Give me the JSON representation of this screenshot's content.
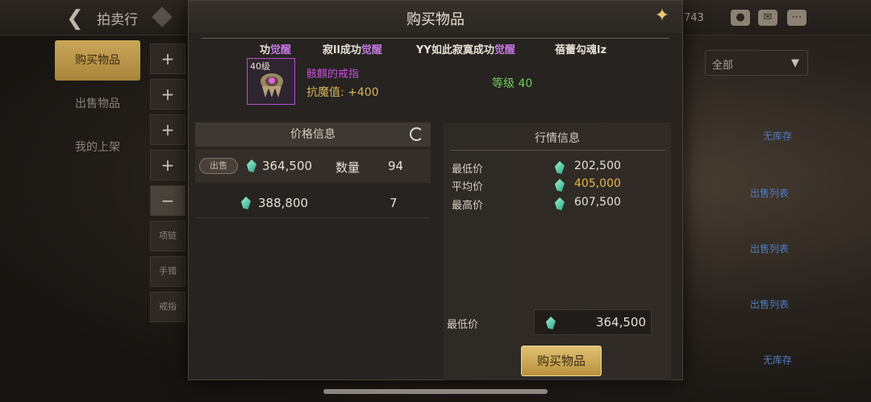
{
  "topbar": {
    "back_icon": "back-arrow-icon",
    "title": "拍卖行",
    "currency_count": "743"
  },
  "sidebar": {
    "items": [
      {
        "label": "购买物品",
        "active": true
      },
      {
        "label": "出售物品",
        "active": false
      },
      {
        "label": "我的上架",
        "active": false
      }
    ]
  },
  "categories": {
    "plus_buttons": [
      "+",
      "+",
      "+",
      "+"
    ],
    "minus": "−",
    "subs": [
      "项链",
      "手镯",
      "戒指"
    ]
  },
  "right_list": {
    "filter_value": "全部",
    "tags": [
      "无库存",
      "出售列表",
      "出售列表",
      "出售列表",
      "无库存"
    ]
  },
  "modal": {
    "title": "购买物品",
    "close_icon": "close-star-icon",
    "names": [
      {
        "pre": "功",
        "hl": "觉醒"
      },
      {
        "pre": "寂ll成功",
        "hl": "觉醒"
      },
      {
        "pre": "YY如此寂寞成功",
        "hl": "觉醒"
      },
      {
        "pre": "蓓蕾勾魂lz",
        "hl": ""
      }
    ],
    "item": {
      "level": "40级",
      "name": "骸麒的戒指",
      "stat": "抗魔值: +400",
      "grade": "等级 40"
    },
    "price_info": {
      "header": "价格信息",
      "rows": [
        {
          "badge": "出售",
          "price": "364,500",
          "qty_label": "数量",
          "qty": "94"
        },
        {
          "badge": "",
          "price": "388,800",
          "qty_label": "",
          "qty": "7"
        }
      ]
    },
    "market_info": {
      "header": "行情信息",
      "rows": [
        {
          "label": "最低价",
          "value": "202,500",
          "highlight": false
        },
        {
          "label": "平均价",
          "value": "405,000",
          "highlight": true
        },
        {
          "label": "最高价",
          "value": "607,500",
          "highlight": false
        }
      ]
    },
    "min_price_label": "最低价",
    "min_price_value": "364,500",
    "buy_button": "购买物品"
  }
}
